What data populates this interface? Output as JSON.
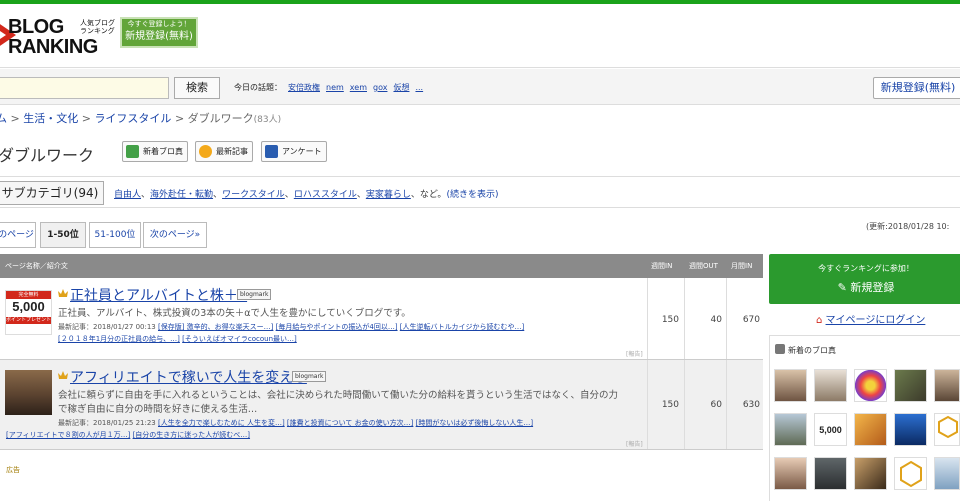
{
  "header": {
    "logo_line1": "BLOG",
    "logo_line2": "RANKING",
    "logo_small": "人気ブログランキング",
    "banner_small": "今すぐ登録しよう！",
    "banner_main": "新規登録(無料)"
  },
  "search": {
    "button": "検索",
    "today_label": "今日の話題：",
    "topics": [
      "安倍政権",
      "nem",
      "xem",
      "gox",
      "仮想",
      "..."
    ],
    "register": "新規登録(無料)"
  },
  "breadcrumb": {
    "items": [
      "ム",
      "生活・文化",
      "ライフスタイル"
    ],
    "current": "ダブルワーク",
    "count": "(83人)"
  },
  "page": {
    "title": "ダブルワーク",
    "buttons": [
      "新着ブロ真",
      "最新記事",
      "アンケート"
    ]
  },
  "categories": {
    "sub_button": "サブカテゴリ(94)",
    "links": [
      "自由人",
      "海外赴任・転勤",
      "ワークスタイル",
      "ロハススタイル",
      "実家暮らし"
    ],
    "suffix": "など。",
    "more": "(続きを表示)"
  },
  "pager": {
    "items": [
      "のページ",
      "1-50位",
      "51-100位",
      "次のページ»"
    ],
    "updated": "(更新:2018/01/28 10:"
  },
  "table": {
    "headers": [
      "ページ名称／紹介文",
      "週間IN",
      "週間OUT",
      "月間IN"
    ],
    "rows": [
      {
        "title": "正社員とアルバイトと株＋α",
        "blogmark": "blogmark",
        "desc": "正社員、アルバイト、株式投資の3本の矢＋αで人生を豊かにしていくブログです。",
        "latest_label": "最新記事：2018/01/27 00:13",
        "latest_links": [
          "[保存版] 激辛的、お得な楽天スー…]",
          "[毎月給与やポイントの振込が4回以…]",
          "[人生逆転バトルカイジから読むむや…]"
        ],
        "latest_links2": [
          "[２０１８年1月分の正社員の給与、…]",
          "[そういえばオマイラcocoun最い…]"
        ],
        "thumb_text1": "完全無料",
        "thumb_text2": "5,000",
        "thumb_text3": "ポイントプレゼント",
        "report": "[報告]",
        "in_week": "150",
        "out_week": "40",
        "in_month": "670"
      },
      {
        "title": "アフィリエイトで稼いで人生を変える",
        "blogmark": "blogmark",
        "desc1": "会社に頼らずに自由を手に入れるということは、会社に決められた時間働いて働いた分の給料を貰うという生活ではなく、自分の力",
        "desc2": "で稼ぎ自由に自分の時間を好きに使える生活…",
        "latest_label": "最新記事：2018/01/25 21:23",
        "latest_links": [
          "[人生を全力で楽しむために 人生を変…]",
          "[誰費と投資について お金の使い方次…]",
          "[時間がないは必ず後悔しない人生…]"
        ],
        "latest_links2": [
          "[アフィリエイトで８割の人が月１万…]",
          "[自分の生き方に迷った人が読むべ…]"
        ],
        "report": "[報告]",
        "in_week": "150",
        "out_week": "60",
        "in_month": "630"
      }
    ],
    "ad_label": "広告"
  },
  "sidebar": {
    "join_small": "今すぐランキングに参加！",
    "join_main": "新規登録",
    "login": "マイページにログイン",
    "new_blogs_title": "新着のブロ真",
    "tile_text1": "5,000"
  },
  "colors": {
    "brand_green": "#2b9a2e",
    "top_stripe": "#1aa31a",
    "link_blue": "#1a44a8",
    "logo_red": "#d2281b",
    "table_header": "#8a8a8a"
  }
}
